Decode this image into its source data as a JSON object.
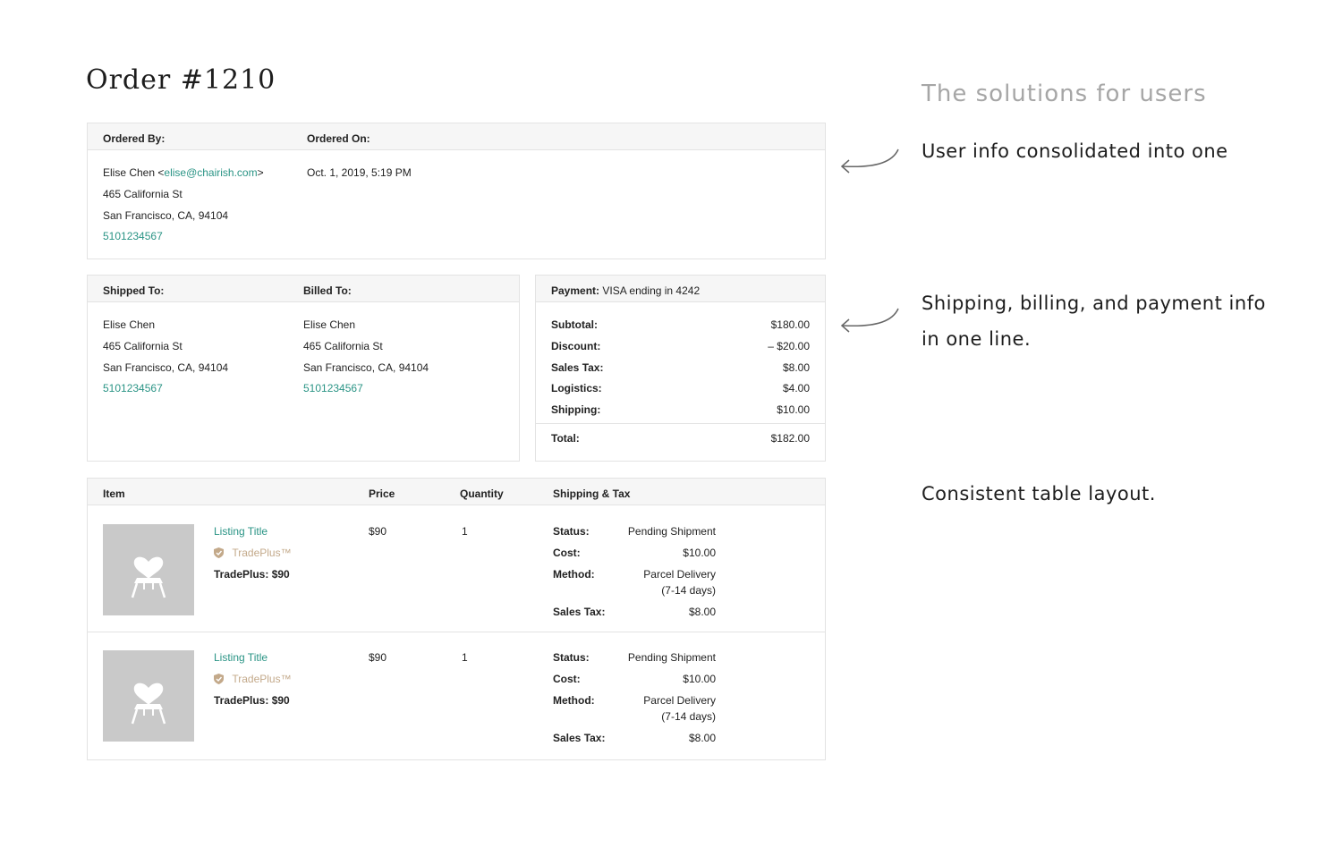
{
  "order": {
    "title": "Order #1210"
  },
  "ordered_card": {
    "ordered_by_label": "Ordered By:",
    "ordered_on_label": "Ordered On:",
    "name": "Elise Chen",
    "email": "elise@chairish.com",
    "email_open": "<",
    "email_close": ">",
    "street": "465 California St",
    "city": "San Francisco, CA, 94104",
    "phone": "5101234567",
    "ordered_on": "Oct. 1, 2019, 5:19 PM"
  },
  "shipping_card": {
    "shipped_to_label": "Shipped To:",
    "billed_to_label": "Billed To:",
    "shipped": {
      "name": "Elise Chen",
      "street": "465 California St",
      "city": "San Francisco, CA, 94104",
      "phone": "5101234567"
    },
    "billed": {
      "name": "Elise Chen",
      "street": "465 California St",
      "city": "San Francisco, CA, 94104",
      "phone": "5101234567"
    }
  },
  "payment_card": {
    "payment_label": "Payment:",
    "payment_method": "VISA ending in 4242",
    "rows": [
      {
        "label": "Subtotal:",
        "value": "$180.00"
      },
      {
        "label": "Discount:",
        "value": "– $20.00"
      },
      {
        "label": "Sales Tax:",
        "value": "$8.00"
      },
      {
        "label": "Logistics:",
        "value": "$4.00"
      },
      {
        "label": "Shipping:",
        "value": "$10.00"
      }
    ],
    "total_label": "Total:",
    "total_value": "$182.00"
  },
  "items_table": {
    "headers": {
      "item": "Item",
      "price": "Price",
      "quantity": "Quantity",
      "shipping_tax": "Shipping & Tax"
    },
    "rows": [
      {
        "title": "Listing Title",
        "badge": "TradePlus™",
        "trade_price": "TradePlus: $90",
        "price": "$90",
        "quantity": "1",
        "status_label": "Status:",
        "status": "Pending Shipment",
        "cost_label": "Cost:",
        "cost": "$10.00",
        "method_label": "Method:",
        "method_line1": "Parcel Delivery",
        "method_line2": "(7-14 days)",
        "tax_label": "Sales Tax:",
        "tax": "$8.00"
      },
      {
        "title": "Listing Title",
        "badge": "TradePlus™",
        "trade_price": "TradePlus: $90",
        "price": "$90",
        "quantity": "1",
        "status_label": "Status:",
        "status": "Pending Shipment",
        "cost_label": "Cost:",
        "cost": "$10.00",
        "method_label": "Method:",
        "method_line1": "Parcel Delivery",
        "method_line2": "(7-14 days)",
        "tax_label": "Sales Tax:",
        "tax": "$8.00"
      }
    ]
  },
  "annotations": {
    "title": "The solutions for users",
    "note1": "User info consolidated into one",
    "note2_line1": "Shipping, billing, and payment info",
    "note2_line2": "in one line.",
    "note3": "Consistent table layout."
  },
  "colors": {
    "link": "#2a9485",
    "badge": "#c3a98a",
    "thumb_bg": "#c9c9c9",
    "header_bg": "#f6f6f6"
  },
  "icons": [
    "shield-check-icon",
    "chair-heart-icon",
    "curved-arrow-left-icon"
  ]
}
